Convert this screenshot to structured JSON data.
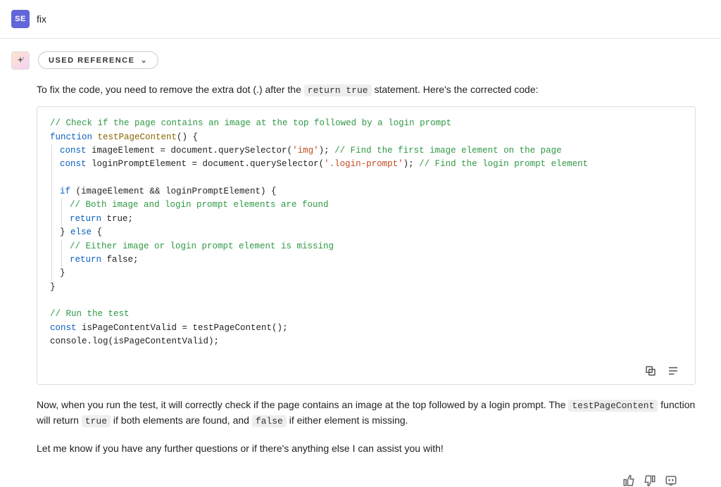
{
  "user": {
    "avatar_initials": "SE",
    "prompt_text": "fix"
  },
  "assistant": {
    "used_reference_label": "USED REFERENCE",
    "intro_before": "To fix the code, you need to remove the extra dot (.) after the ",
    "intro_code": "return true",
    "intro_after": " statement. Here's the corrected code:",
    "code": {
      "l1": "// Check if the page contains an image at the top followed by a login prompt",
      "l2_kw": "function",
      "l2_fn": " testPageContent",
      "l2_rest": "() {",
      "l3_kw": "const",
      "l3_rest_a": " imageElement = document.querySelector(",
      "l3_str": "'img'",
      "l3_rest_b": "); ",
      "l3_cm": "// Find the first image element on the page",
      "l4_kw": "const",
      "l4_rest_a": " loginPromptElement = document.querySelector(",
      "l4_str": "'.login-prompt'",
      "l4_rest_b": "); ",
      "l4_cm": "// Find the login prompt element",
      "l6_kw": "if",
      "l6_rest": " (imageElement && loginPromptElement) {",
      "l7_cm": "// Both image and login prompt elements are found",
      "l8_kw": "return",
      "l8_rest": " true;",
      "l9_rest": "} ",
      "l9_kw": "else",
      "l9_rest2": " {",
      "l10_cm": "// Either image or login prompt element is missing",
      "l11_kw": "return",
      "l11_rest": " false;",
      "l12": "}",
      "l13": "}",
      "l15_cm": "// Run the test",
      "l16_kw": "const",
      "l16_rest": " isPageContentValid = testPageContent();",
      "l17": "console.log(isPageContentValid);"
    },
    "outro_1a": "Now, when you run the test, it will correctly check if the page contains an image at the top followed by a login prompt. The ",
    "outro_1_code1": "testPageContent",
    "outro_1b": " function will return ",
    "outro_1_code2": "true",
    "outro_1c": " if both elements are found, and ",
    "outro_1_code3": "false",
    "outro_1d": " if either element is missing.",
    "outro_2": "Let me know if you have any further questions or if there's anything else I can assist you with!"
  }
}
